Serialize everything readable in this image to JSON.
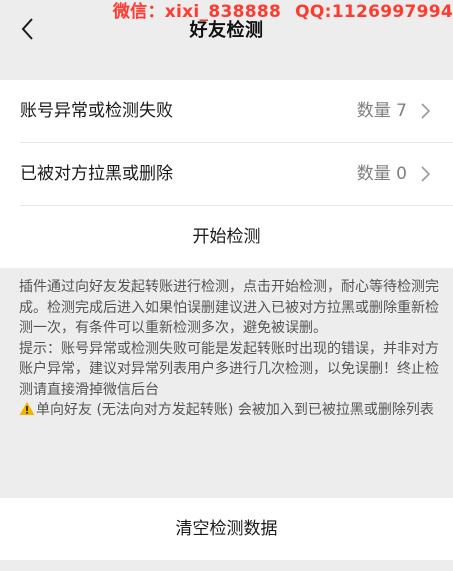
{
  "header": {
    "title": "好友检测",
    "back_icon": "chevron-left-icon"
  },
  "watermark": {
    "wechat": "微信：xixi_838888",
    "qq": "QQ:1126997994",
    "color": "#ff3b30"
  },
  "rows": [
    {
      "label": "账号异常或检测失败",
      "count": "数量 7",
      "icon": "chevron-right-icon"
    },
    {
      "label": "已被对方拉黑或删除",
      "count": "数量 0",
      "icon": "chevron-right-icon"
    }
  ],
  "start_button": {
    "label": "开始检测"
  },
  "description": {
    "para1": "插件通过向好友发起转账进行检测，点击开始检测，耐心等待检测完成。检测完成后进入如果怕误删建议进入已被对方拉黑或删除重新检测一次，有条件可以重新检测多次，避免被误删。",
    "para2": "提示：账号异常或检测失败可能是发起转账时出现的错误，并非对方账户异常，建议对异常列表用户多进行几次检测，以免误删！终止检测请直接滑掉微信后台",
    "para3": "单向好友 (无法向对方发起转账) 会被加入到已被拉黑或删除列表",
    "warning_icon": "warning-icon"
  },
  "clear_button": {
    "label": "清空检测数据"
  }
}
